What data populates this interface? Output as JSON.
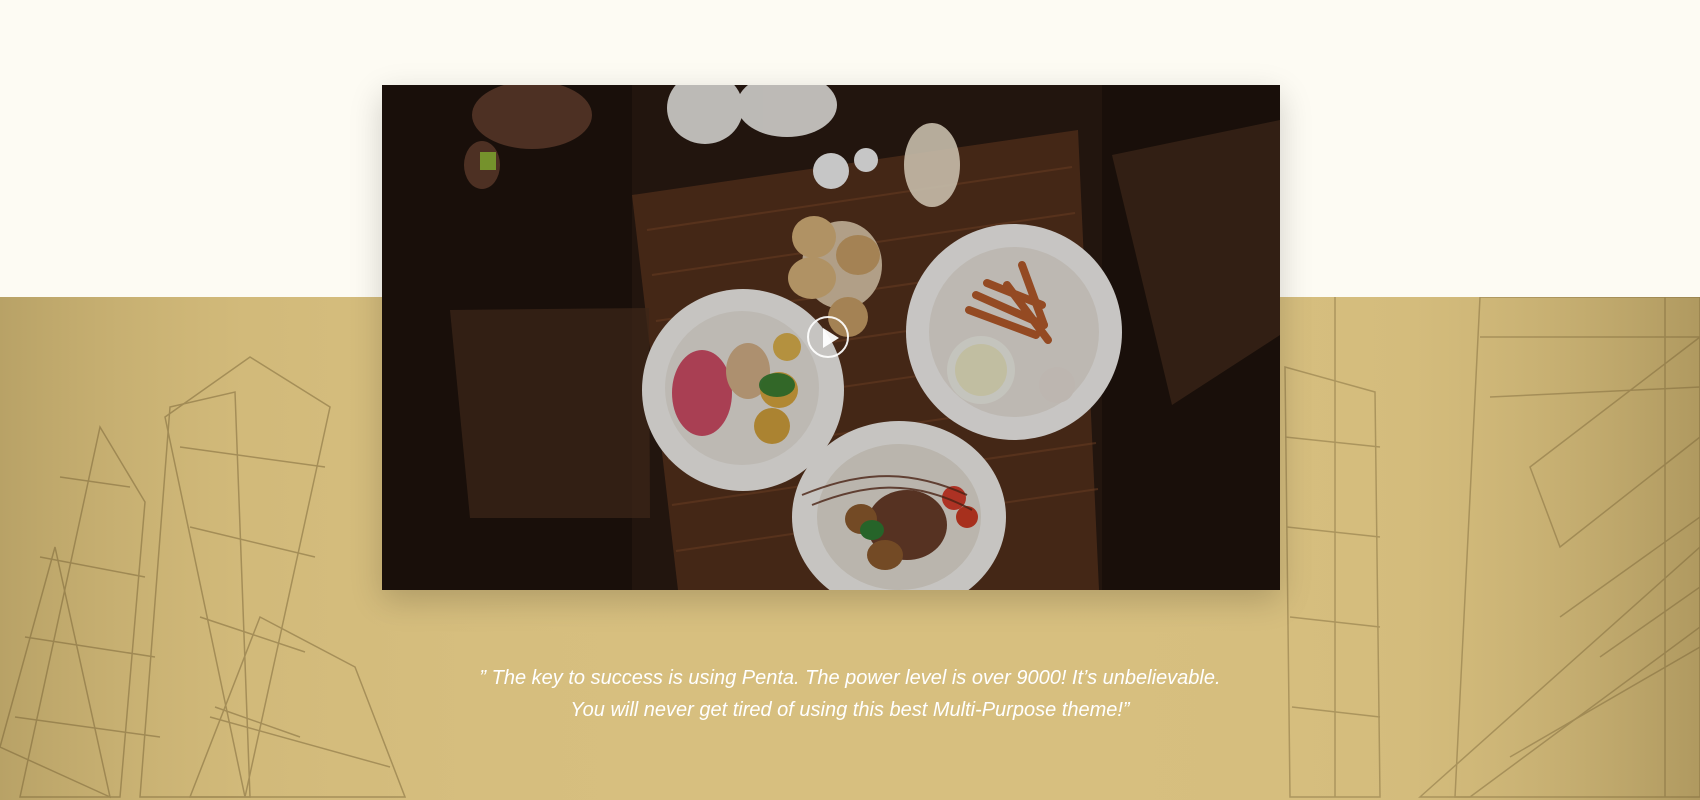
{
  "colors": {
    "cream_background": "#fdfbf3",
    "gold_overlay": "#d7bf7f",
    "quote_text": "#ffffff"
  },
  "video": {
    "image_description": "overhead restaurant table with plated dishes",
    "play_icon": "play-icon"
  },
  "quote": {
    "line1": "” The key to success is using Penta. The power level is over 9000! It’s unbelievable.",
    "line2": "You will never get tired of using this best Multi-Purpose theme!”"
  },
  "background": {
    "image_description": "glass skyscrapers with gold tint"
  }
}
